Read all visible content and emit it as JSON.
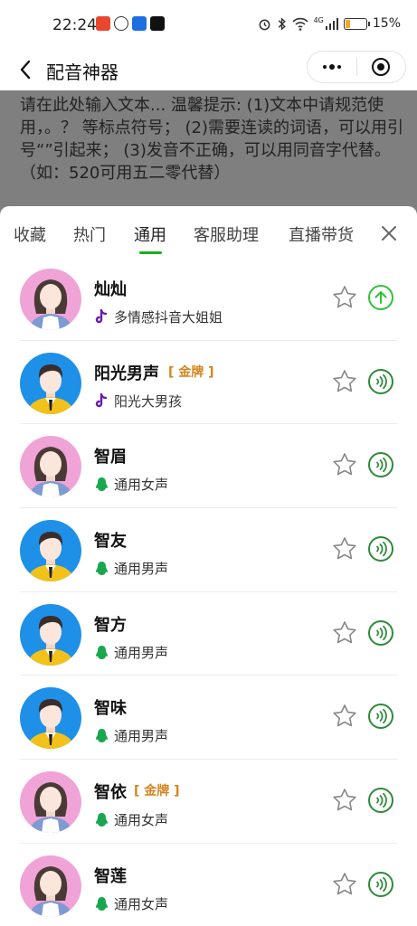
{
  "status": {
    "time": "22:24",
    "battery": "15%",
    "signal_label": "4G"
  },
  "nav": {
    "title": "配音神器"
  },
  "input": {
    "placeholder_text": "请在此处输入文本... 温馨提示: (1)文本中请规范使用，。？ 等标点符号； (2)需要连读的词语，可以用引号“”引起来； (3)发音不正确，可以用同音字代替。（如：520可用五二零代替）"
  },
  "tabs": [
    {
      "label": "收藏"
    },
    {
      "label": "热门"
    },
    {
      "label": "通用"
    },
    {
      "label": "客服助理"
    },
    {
      "label": "直播带货"
    }
  ],
  "active_tab_index": 2,
  "colors": {
    "accent_green": "#1aad19",
    "gold_badge": "#d4841b",
    "female_avatar_bg": "#f0a3d6",
    "male_avatar_bg": "#1e90e8"
  },
  "voices": [
    {
      "name": "灿灿",
      "badge": "",
      "gender": "female",
      "source_icon": "tiktok-icon",
      "subtitle": "多情感抖音大姐姐",
      "action": "upload-icon"
    },
    {
      "name": "阳光男声",
      "badge": "[ 金牌 ]",
      "gender": "male",
      "source_icon": "tiktok-icon",
      "subtitle": "阳光大男孩",
      "action": "play-icon"
    },
    {
      "name": "智眉",
      "badge": "",
      "gender": "female",
      "source_icon": "penguin-icon",
      "subtitle": "通用女声",
      "action": "play-icon"
    },
    {
      "name": "智友",
      "badge": "",
      "gender": "male",
      "source_icon": "penguin-icon",
      "subtitle": "通用男声",
      "action": "play-icon"
    },
    {
      "name": "智方",
      "badge": "",
      "gender": "male",
      "source_icon": "penguin-icon",
      "subtitle": "通用男声",
      "action": "play-icon"
    },
    {
      "name": "智味",
      "badge": "",
      "gender": "male",
      "source_icon": "penguin-icon",
      "subtitle": "通用男声",
      "action": "play-icon"
    },
    {
      "name": "智依",
      "badge": "[ 金牌 ]",
      "gender": "female",
      "source_icon": "penguin-icon",
      "subtitle": "通用女声",
      "action": "play-icon"
    },
    {
      "name": "智莲",
      "badge": "",
      "gender": "female",
      "source_icon": "penguin-icon",
      "subtitle": "通用女声",
      "action": "play-icon"
    }
  ]
}
